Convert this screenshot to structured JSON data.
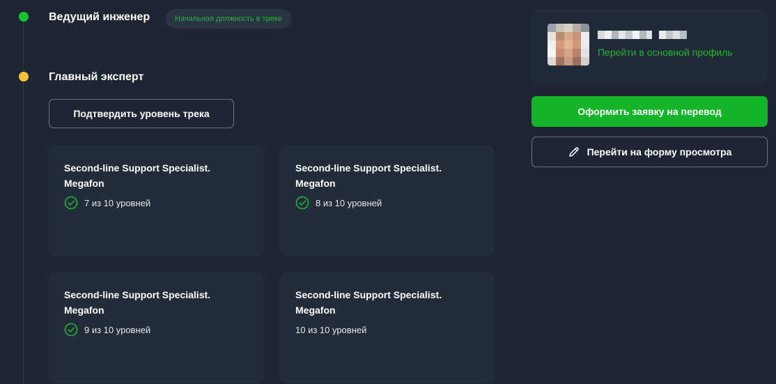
{
  "timeline": {
    "levels": [
      {
        "title": "Ведущий инженер",
        "badge": "Начальная должность в треке",
        "dot_color": "#18c42d"
      },
      {
        "title": "Главный эксперт",
        "dot_color": "#f5c23b"
      }
    ],
    "confirm_button": "Подтвердить уровень трека"
  },
  "cards": [
    {
      "title": "Second-line Support Specialist. Megafon",
      "progress": "7 из 10 уровней",
      "icon": "check-circle-icon"
    },
    {
      "title": "Second-line Support Specialist. Megafon",
      "progress": "8 из 10 уровней",
      "icon": "check-circle-icon"
    },
    {
      "title": "Second-line Support Specialist. Megafon",
      "progress": "9 из 10 уровней",
      "icon": "check-circle-icon"
    },
    {
      "title": "Second-line Support Specialist. Megafon",
      "progress": "10 из 10 уровней"
    }
  ],
  "profile": {
    "link": "Перейти в основной профиль"
  },
  "actions": {
    "transfer_button": "Оформить заявку на перевод",
    "view_button": "Перейти на форму просмотра",
    "view_icon": "pencil-icon"
  },
  "colors": {
    "background": "#1e2633",
    "accent_green": "#15b52a",
    "current_level": "#f5c23b"
  }
}
